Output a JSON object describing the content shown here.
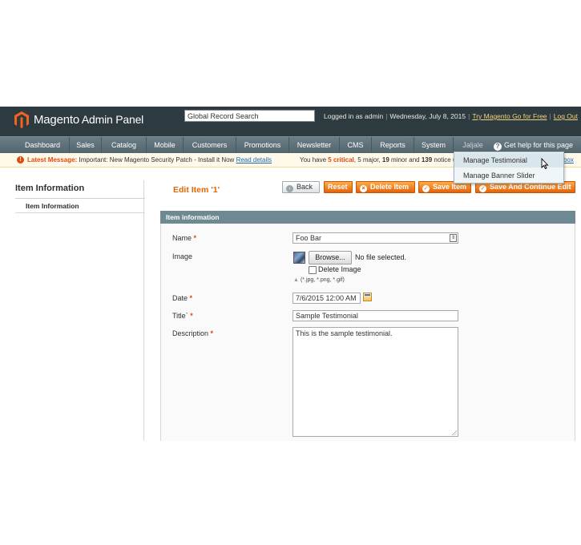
{
  "header": {
    "logo_text": "Magento",
    "logo_sub": " Admin Panel",
    "search_value": "Global Record Search",
    "logged_in": "Logged in as admin",
    "date": "Wednesday, July 8, 2015",
    "try_link": "Try Magento Go for Free",
    "logout": "Log Out"
  },
  "nav": {
    "items": [
      "Dashboard",
      "Sales",
      "Catalog",
      "Mobile",
      "Customers",
      "Promotions",
      "Newsletter",
      "CMS",
      "Reports",
      "System",
      "Jaljale"
    ],
    "help": "Get help for this page"
  },
  "message": {
    "label": "Latest Message:",
    "text": " Important: New Magento Security Patch - Install it Now ",
    "link": "Read details",
    "right_prefix": "You have ",
    "critical_count": "5 critical",
    "major": ", 5 major, ",
    "minor": "19",
    "minor_suffix": " minor and ",
    "notice": "139",
    "notice_suffix": " notice u",
    "box_link": "box"
  },
  "dropdown": {
    "items": [
      "Manage Testimonial",
      "Manage Banner Slider"
    ]
  },
  "sidebar": {
    "title": "Item Information",
    "items": [
      "Item Information"
    ]
  },
  "page": {
    "title": "Edit Item '1'",
    "buttons": {
      "back": "Back",
      "reset": "Reset",
      "delete": "Delete Item",
      "save": "Save Item",
      "save_continue": "Save And Continue Edit"
    }
  },
  "form": {
    "section_title": "Item information",
    "name_label": "Name",
    "name_value": "Foo Bar",
    "image_label": "Image",
    "browse_label": "Browse...",
    "no_file": "No file selected.",
    "delete_image_label": "Delete Image",
    "image_note": "(*.jpg, *.png, *.gif)",
    "date_label": "Date",
    "date_value": "7/6/2015 12:00 AM",
    "title_label": "Title`",
    "title_value": "Sample Testimonial",
    "description_label": "Description",
    "description_value": "This is the sample testimonial.",
    "required_mark": "*"
  },
  "colors": {
    "header_bg": "#2d3a40",
    "nav_bg": "#53656d",
    "accent_orange": "#e26703",
    "section_bg": "#6f8992"
  }
}
